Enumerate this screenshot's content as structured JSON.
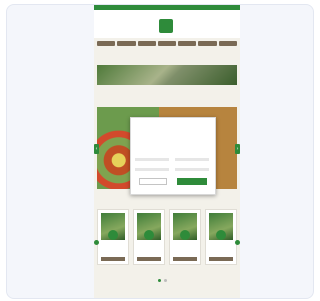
{
  "site": {
    "brand_text": "",
    "logo_text": "",
    "nav_items": [
      "",
      "",
      "",
      "",
      "",
      "",
      ""
    ],
    "breadcrumb": "",
    "sections": {
      "featured_title": "",
      "products_title": "",
      "footer_title": ""
    },
    "promo_title": "",
    "colors": {
      "brand_green": "#2e8b3a",
      "nav_brown": "#7a6a55",
      "promo_bg": "#b7843e",
      "page_bg": "#f3f1ea"
    }
  },
  "consent_modal": {
    "title": "",
    "body": "",
    "option_labels": [
      "",
      "",
      "",
      ""
    ],
    "decline_label": "",
    "accept_label": "",
    "links": [
      "",
      "",
      "",
      ""
    ]
  },
  "products": [
    {
      "name": "",
      "badge": ""
    },
    {
      "name": "",
      "badge": ""
    },
    {
      "name": "",
      "badge": ""
    },
    {
      "name": "",
      "badge": ""
    }
  ],
  "icons": {
    "prev": "chevron-left-icon",
    "next": "chevron-right-icon"
  }
}
